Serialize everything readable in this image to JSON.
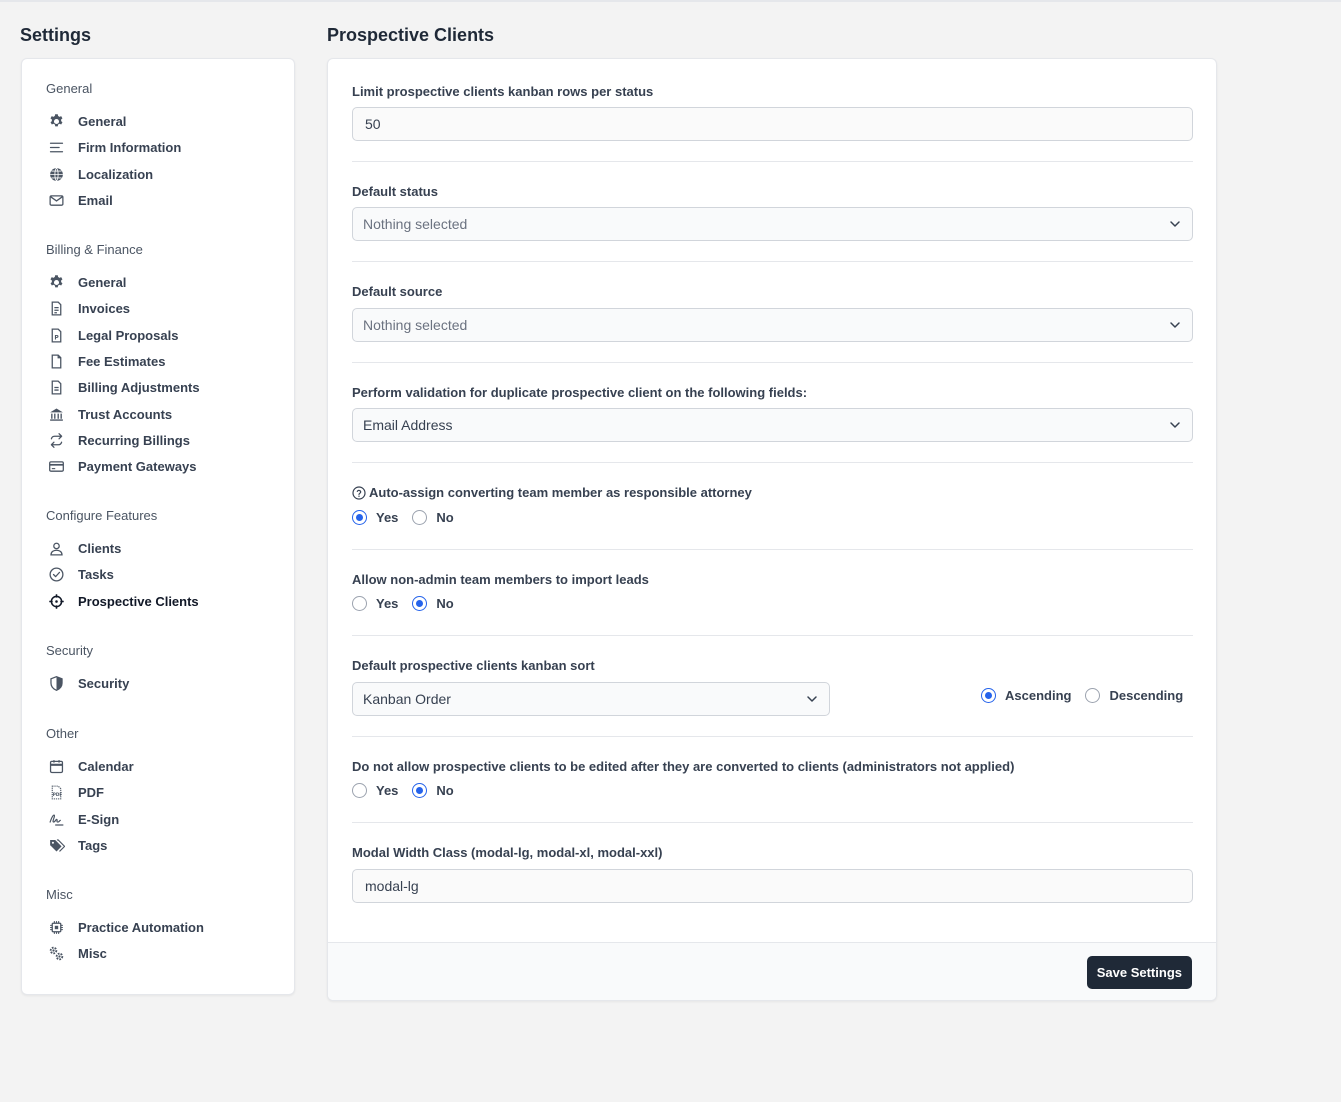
{
  "page_title": "Settings",
  "main_title": "Prospective Clients",
  "sidebar": {
    "sections": [
      {
        "title": "General",
        "items": [
          {
            "label": "General",
            "icon": "gear-icon"
          },
          {
            "label": "Firm Information",
            "icon": "lines-icon"
          },
          {
            "label": "Localization",
            "icon": "globe-icon"
          },
          {
            "label": "Email",
            "icon": "envelope-icon"
          }
        ]
      },
      {
        "title": "Billing & Finance",
        "items": [
          {
            "label": "General",
            "icon": "gear-icon"
          },
          {
            "label": "Invoices",
            "icon": "invoice-icon"
          },
          {
            "label": "Legal Proposals",
            "icon": "proposal-icon"
          },
          {
            "label": "Fee Estimates",
            "icon": "document-icon"
          },
          {
            "label": "Billing Adjustments",
            "icon": "document-lines-icon"
          },
          {
            "label": "Trust Accounts",
            "icon": "bank-icon"
          },
          {
            "label": "Recurring Billings",
            "icon": "repeat-icon"
          },
          {
            "label": "Payment Gateways",
            "icon": "credit-card-icon"
          }
        ]
      },
      {
        "title": "Configure Features",
        "items": [
          {
            "label": "Clients",
            "icon": "user-icon"
          },
          {
            "label": "Tasks",
            "icon": "check-circle-icon"
          },
          {
            "label": "Prospective Clients",
            "icon": "crosshair-icon",
            "active": true
          }
        ]
      },
      {
        "title": "Security",
        "items": [
          {
            "label": "Security",
            "icon": "shield-icon"
          }
        ]
      },
      {
        "title": "Other",
        "items": [
          {
            "label": "Calendar",
            "icon": "calendar-icon"
          },
          {
            "label": "PDF",
            "icon": "pdf-icon"
          },
          {
            "label": "E-Sign",
            "icon": "signature-icon"
          },
          {
            "label": "Tags",
            "icon": "tags-icon"
          }
        ]
      },
      {
        "title": "Misc",
        "items": [
          {
            "label": "Practice Automation",
            "icon": "chip-icon"
          },
          {
            "label": "Misc",
            "icon": "gears-icon"
          }
        ]
      }
    ]
  },
  "form": {
    "kanban_limit": {
      "label": "Limit prospective clients kanban rows per status",
      "value": "50"
    },
    "default_status": {
      "label": "Default status",
      "value": "Nothing selected"
    },
    "default_source": {
      "label": "Default source",
      "value": "Nothing selected"
    },
    "duplicate_validation": {
      "label": "Perform validation for duplicate prospective client on the following fields:",
      "value": "Email Address"
    },
    "auto_assign": {
      "label": "Auto-assign converting team member as responsible attorney",
      "yes": "Yes",
      "no": "No",
      "selected": "Yes"
    },
    "allow_import": {
      "label": "Allow non-admin team members to import leads",
      "yes": "Yes",
      "no": "No",
      "selected": "No"
    },
    "kanban_sort": {
      "label": "Default prospective clients kanban sort",
      "value": "Kanban Order",
      "ascending": "Ascending",
      "descending": "Descending",
      "selected": "Ascending"
    },
    "no_edit_after_convert": {
      "label": "Do not allow prospective clients to be edited after they are converted to clients (administrators not applied)",
      "yes": "Yes",
      "no": "No",
      "selected": "No"
    },
    "modal_width": {
      "label": "Modal Width Class (modal-lg, modal-xl, modal-xxl)",
      "value": "modal-lg"
    }
  },
  "footer": {
    "save_label": "Save Settings"
  },
  "colors": {
    "accent": "#2563eb",
    "button_bg": "#1f2937"
  }
}
